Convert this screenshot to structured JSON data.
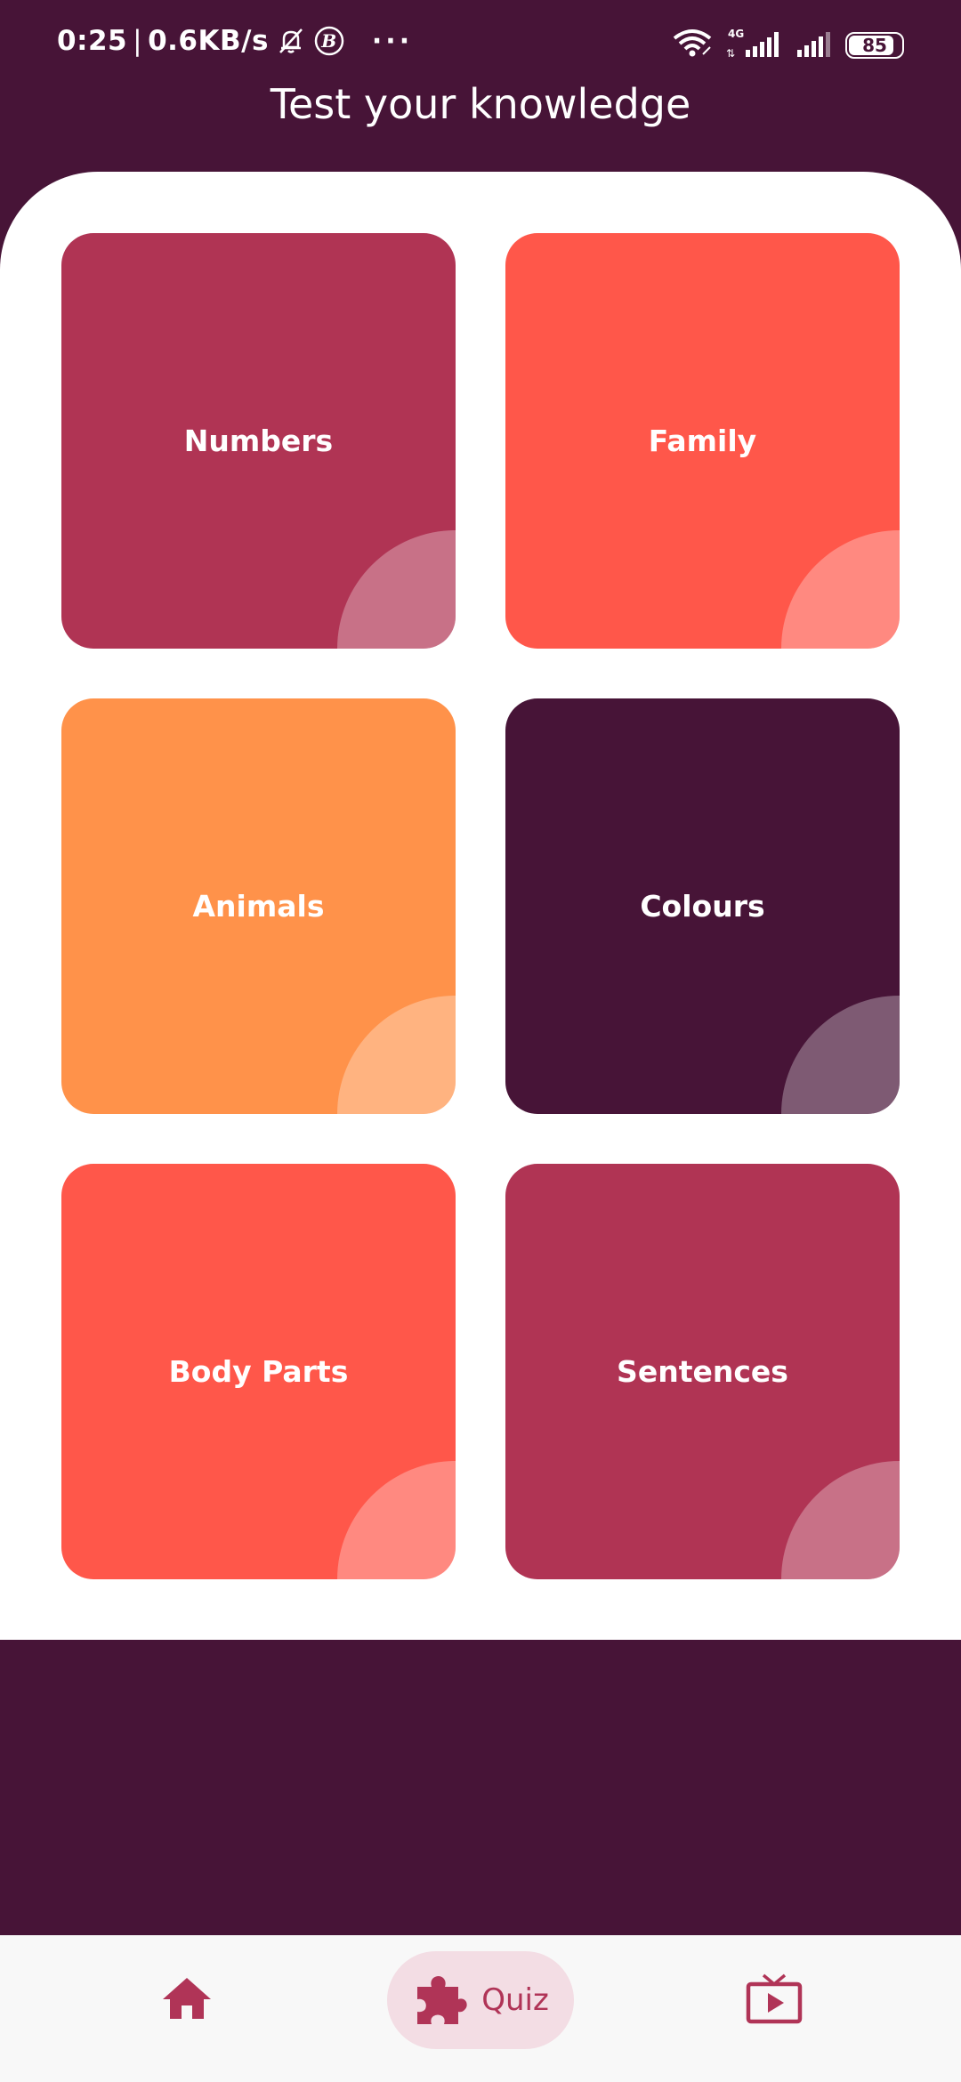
{
  "status_bar": {
    "time": "0:25",
    "speed": "0.6KB/s",
    "network": "4G",
    "battery": "85",
    "more": "···"
  },
  "header": {
    "title": "Test your knowledge"
  },
  "categories": [
    {
      "label": "Numbers",
      "color": "#B03454"
    },
    {
      "label": "Family",
      "color": "#FF574A"
    },
    {
      "label": "Animals",
      "color": "#FF924A"
    },
    {
      "label": "Colours",
      "color": "#471437"
    },
    {
      "label": "Body Parts",
      "color": "#FF574A"
    },
    {
      "label": "Sentences",
      "color": "#B03454"
    }
  ],
  "bottom_nav": {
    "items": [
      {
        "icon": "home-icon",
        "label": ""
      },
      {
        "icon": "puzzle-icon",
        "label": "Quiz",
        "active": true
      },
      {
        "icon": "tv-icon",
        "label": ""
      }
    ],
    "accent": "#B03457"
  },
  "colors": {
    "background": "#471437",
    "panel": "#FFFFFF",
    "nav_background": "#F8F8F8",
    "active_pill": "#F3DDE4"
  }
}
